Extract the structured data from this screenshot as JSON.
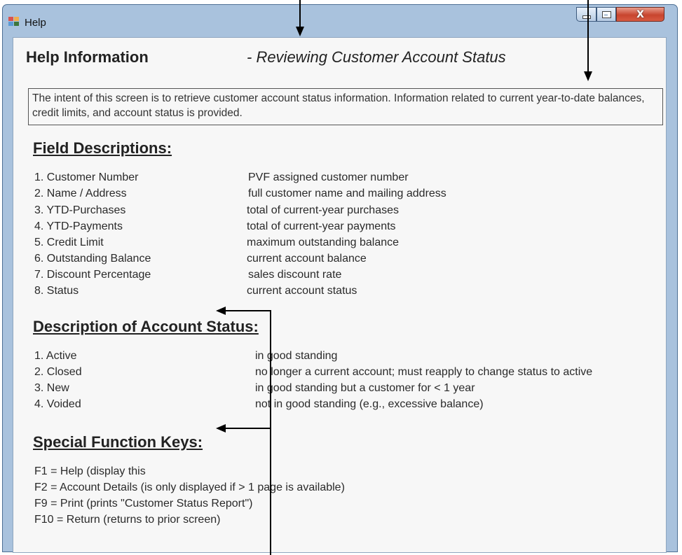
{
  "window": {
    "title": "Help"
  },
  "header": {
    "title": "Help Information",
    "subtitle": "- Reviewing Customer Account Status"
  },
  "intro": "The intent of this screen is to retrieve customer account status information. Information related to current year-to-date balances, credit limits, and account status is provided.",
  "fields": {
    "heading": "Field Descriptions:",
    "items": [
      {
        "label": "1. Customer Number",
        "desc": "PVF assigned customer number"
      },
      {
        "label": "2. Name / Address",
        "desc": "full customer name and mailing address"
      },
      {
        "label": "3. YTD-Purchases",
        "desc": "total of current-year purchases"
      },
      {
        "label": "4. YTD-Payments",
        "desc": "total of current-year payments"
      },
      {
        "label": "5. Credit Limit",
        "desc": "maximum outstanding balance"
      },
      {
        "label": "6. Outstanding Balance",
        "desc": "current account balance"
      },
      {
        "label": "7. Discount Percentage",
        "desc": "sales discount rate"
      },
      {
        "label": "8. Status",
        "desc": "current account status"
      }
    ]
  },
  "statuses": {
    "heading": "Description of Account Status:",
    "items": [
      {
        "label": "1. Active",
        "desc": "in good standing"
      },
      {
        "label": "2. Closed",
        "desc": "no longer a current account; must reapply to change status to active"
      },
      {
        "label": "3. New",
        "desc": "in good standing but a customer for < 1 year"
      },
      {
        "label": "4. Voided",
        "desc": "not in good standing (e.g., excessive balance)"
      }
    ]
  },
  "keys": {
    "heading": "Special Function Keys:",
    "items": [
      "F1 = Help (display this",
      "F2 = Account Details (is only displayed if > 1 page is available)",
      "F9 = Print (prints \"Customer Status Report\")",
      "F10 = Return (returns to prior screen)"
    ]
  },
  "colors": {
    "frame": "#a9c2dd",
    "content_bg": "#f7f7f7",
    "close_button": "#c8452f"
  },
  "icons": [
    "app-window-icon",
    "minimize-icon",
    "maximize-icon",
    "close-icon"
  ]
}
